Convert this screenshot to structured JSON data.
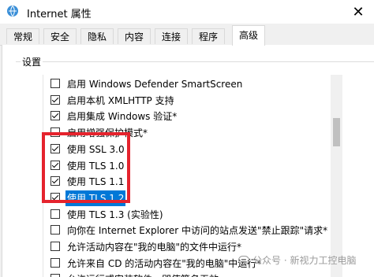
{
  "window": {
    "title": "Internet 属性",
    "close_glyph": "✕"
  },
  "tabs": [
    "常规",
    "安全",
    "隐私",
    "内容",
    "连接",
    "程序",
    "高级"
  ],
  "active_tab": "高级",
  "settings_group_label": "设置",
  "items": [
    {
      "label": "启用 Windows Defender SmartScreen",
      "checked": false
    },
    {
      "label": "启用本机 XMLHTTP 支持",
      "checked": true
    },
    {
      "label": "启用集成 Windows 验证*",
      "checked": true
    },
    {
      "label": "启用增强保护模式*",
      "checked": false
    },
    {
      "label": "使用 SSL 3.0",
      "checked": true
    },
    {
      "label": "使用 TLS 1.0",
      "checked": true
    },
    {
      "label": "使用 TLS 1.1",
      "checked": true
    },
    {
      "label": "使用 TLS 1.2",
      "checked": true,
      "selected": true
    },
    {
      "label": "使用 TLS 1.3 (实验性)",
      "checked": false
    },
    {
      "label": "向你在 Internet Explorer 中访问的站点发送\"禁止跟踪\"请求*",
      "checked": false
    },
    {
      "label": "允许活动内容在\"我的电脑\"的文件中运行*",
      "checked": false
    },
    {
      "label": "允许来自 CD 的活动内容在\"我的电脑\"中运行*",
      "checked": false
    },
    {
      "label": "允许运行或安装软件，即使签名无效",
      "checked": false
    }
  ],
  "watermark": "公众号 · 新视力工控电脑",
  "colors": {
    "highlight_border": "#e5232d",
    "selection": "#0078d7"
  }
}
